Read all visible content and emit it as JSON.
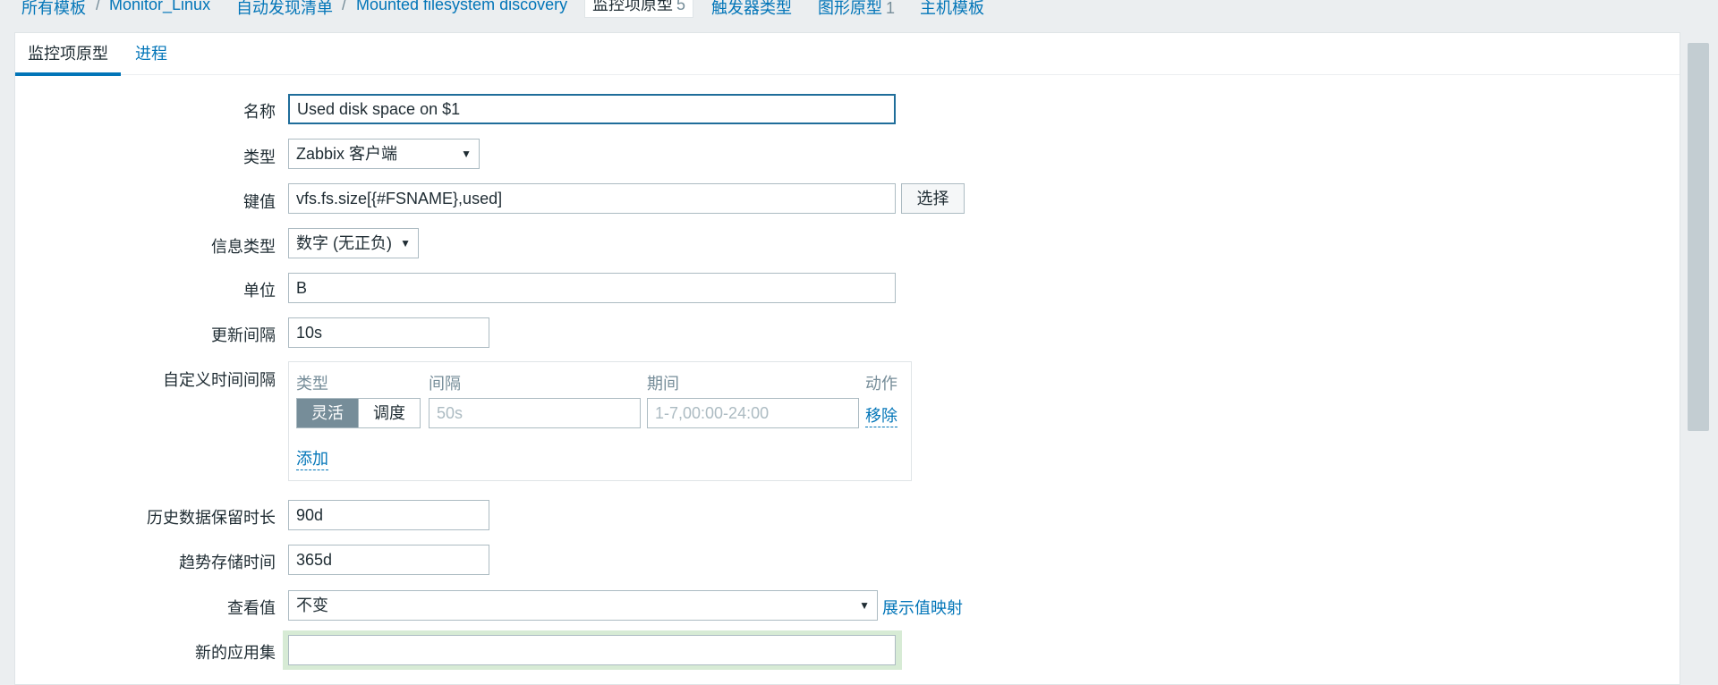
{
  "breadcrumb": {
    "all_templates": "所有模板",
    "template": "Monitor_Linux",
    "discovery_list": "自动发现清单",
    "discovery_rule": "Mounted filesystem discovery",
    "item_prototypes": "监控项原型",
    "item_prototypes_count": "5",
    "trigger_types": "触发器类型",
    "graph_prototypes": "图形原型",
    "graph_prototypes_count": "1",
    "host_templates": "主机模板"
  },
  "tabs": [
    "监控项原型",
    "进程"
  ],
  "form": {
    "name_label": "名称",
    "name_value": "Used disk space on $1",
    "type_label": "类型",
    "type_value": "Zabbix 客户端",
    "key_label": "键值",
    "key_value": "vfs.fs.size[{#FSNAME},used]",
    "key_button": "选择",
    "info_type_label": "信息类型",
    "info_type_value": "数字 (无正负)",
    "units_label": "单位",
    "units_value": "B",
    "interval_label": "更新间隔",
    "interval_value": "10s",
    "custom_label": "自定义时间间隔",
    "custom": {
      "col_type": "类型",
      "col_interval": "间隔",
      "col_period": "期间",
      "col_action": "动作",
      "flexible": "灵活",
      "scheduling": "调度",
      "interval_placeholder": "50s",
      "period_placeholder": "1-7,00:00-24:00",
      "remove": "移除",
      "add": "添加"
    },
    "history_label": "历史数据保留时长",
    "history_value": "90d",
    "trends_label": "趋势存储时间",
    "trends_value": "365d",
    "valuemap_label": "查看值",
    "valuemap_value": "不变",
    "valuemap_link": "展示值映射",
    "new_app_label": "新的应用集",
    "new_app_value": ""
  },
  "colors": {
    "link": "#0275b8",
    "active_toggle": "#768d99",
    "focus_border": "#1f6d9a"
  }
}
